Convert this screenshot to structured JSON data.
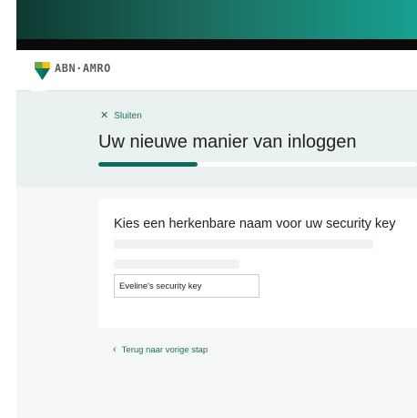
{
  "brand": {
    "name": "ABN·AMRO",
    "logo_icon": "abn-amro-shield-icon",
    "colors": {
      "green": "#0d6b5e",
      "yellow": "#f4c20d",
      "teal": "#17a090"
    }
  },
  "navigation": {
    "close_label": "Sluiten",
    "close_icon": "close-icon",
    "back_label": "Terug naar vorige stap",
    "back_icon": "chevron-left-icon"
  },
  "wizard": {
    "title": "Uw nieuwe manier van inloggen",
    "progress_fraction": 0.31
  },
  "form": {
    "title": "Kies een herkenbare naam voor uw security key",
    "key_name_value": "Eveline's security key"
  }
}
